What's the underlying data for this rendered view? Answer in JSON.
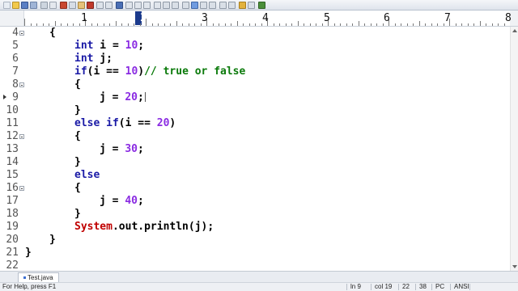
{
  "ruler": {
    "numbers": [
      "1",
      "2",
      "3",
      "4",
      "5",
      "6",
      "7",
      "8"
    ]
  },
  "code_lines": [
    {
      "num": "4",
      "fold": true
    },
    {
      "num": "5",
      "fold": false
    },
    {
      "num": "6",
      "fold": false
    },
    {
      "num": "7",
      "fold": false
    },
    {
      "num": "8",
      "fold": true
    },
    {
      "num": "9",
      "fold": false
    },
    {
      "num": "10",
      "fold": false
    },
    {
      "num": "11",
      "fold": false
    },
    {
      "num": "12",
      "fold": true
    },
    {
      "num": "13",
      "fold": false
    },
    {
      "num": "14",
      "fold": false
    },
    {
      "num": "15",
      "fold": false
    },
    {
      "num": "16",
      "fold": true
    },
    {
      "num": "17",
      "fold": false
    },
    {
      "num": "18",
      "fold": false
    },
    {
      "num": "19",
      "fold": false
    },
    {
      "num": "20",
      "fold": false
    },
    {
      "num": "21",
      "fold": false
    },
    {
      "num": "22",
      "fold": false
    }
  ],
  "code": {
    "l4_brace": "{",
    "l5_type": "int",
    "l5_rest": " i = ",
    "l5_val": "10",
    "l5_end": ";",
    "l6_type": "int",
    "l6_rest": " j;",
    "l7_kw": "if",
    "l7_cond": "(i == ",
    "l7_val": "10",
    "l7_close": ")",
    "l7_comment": "// true or false",
    "l8_brace": "{",
    "l9_lhs": "j = ",
    "l9_val": "20",
    "l9_end": ";",
    "l10_brace": "}",
    "l11_kw": "else if",
    "l11_cond": "(i == ",
    "l11_val": "20",
    "l11_close": ")",
    "l12_brace": "{",
    "l13_lhs": "j = ",
    "l13_val": "30",
    "l13_end": ";",
    "l14_brace": "}",
    "l15_kw": "else",
    "l16_brace": "{",
    "l17_lhs": "j = ",
    "l17_val": "40",
    "l17_end": ";",
    "l18_brace": "}",
    "l19_cls": "System",
    "l19_rest": ".out.println(j);",
    "l20_brace": "}",
    "l21_brace": "}"
  },
  "tab": {
    "label": "Test.java"
  },
  "status": {
    "help": "For Help, press F1",
    "line": "ln 9",
    "col": "col 19",
    "sel": "22",
    "num": "38",
    "mode": "PC",
    "encoding": "ANSI"
  },
  "colors": {
    "keyword": "#1a1aa6",
    "number": "#8a2be2",
    "class": "#c00000",
    "comment": "#0a7a0a"
  }
}
